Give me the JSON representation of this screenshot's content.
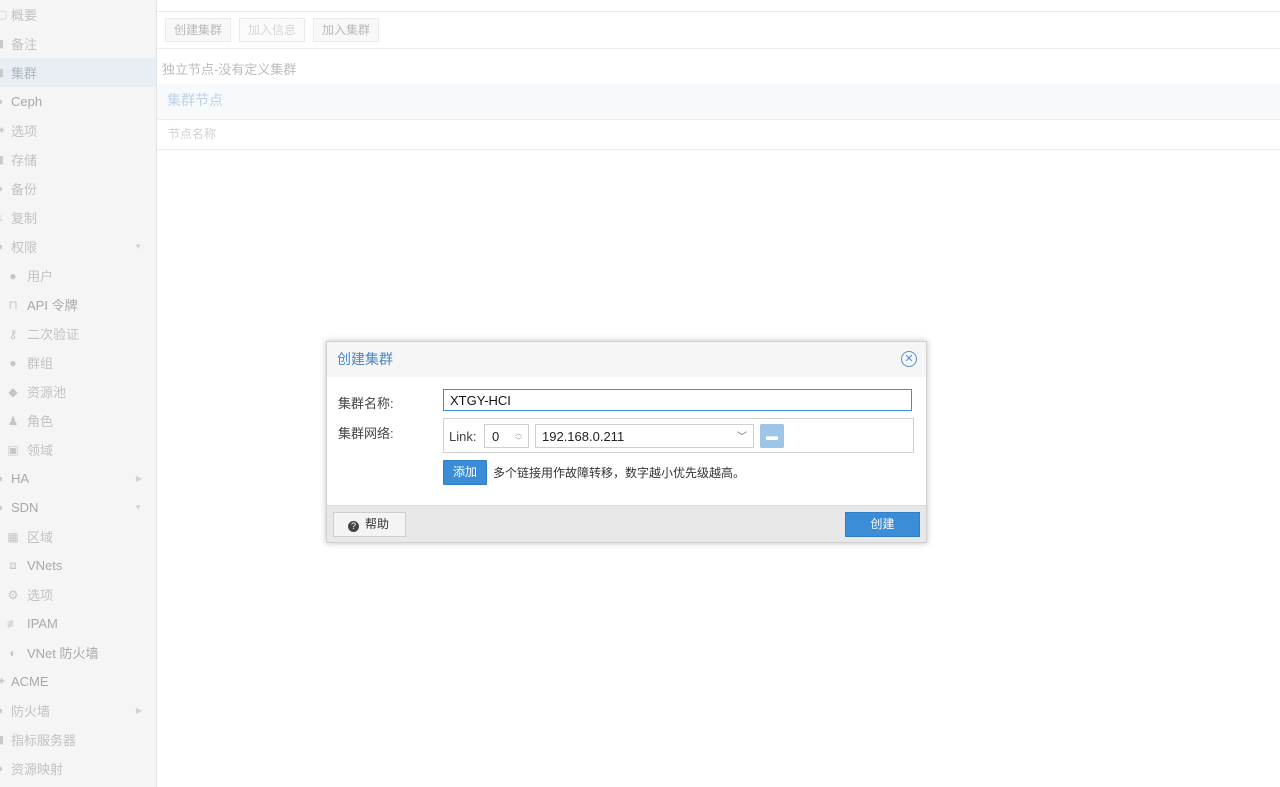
{
  "sidebar": {
    "items": [
      {
        "label": "概要",
        "icon": "summary-icon"
      },
      {
        "label": "备注",
        "icon": "notes-icon"
      },
      {
        "label": "集群",
        "icon": "cluster-icon",
        "selected": true
      },
      {
        "label": "Ceph",
        "icon": "ceph-icon"
      },
      {
        "label": "选项",
        "icon": "options-icon"
      },
      {
        "label": "存储",
        "icon": "storage-icon"
      },
      {
        "label": "备份",
        "icon": "backup-icon"
      },
      {
        "label": "复制",
        "icon": "replication-icon"
      },
      {
        "label": "权限",
        "icon": "permissions-icon",
        "expanded": true
      },
      {
        "label": "用户",
        "icon": "user-icon"
      },
      {
        "label": "API 令牌",
        "icon": "api-token-icon"
      },
      {
        "label": "二次验证",
        "icon": "key-icon"
      },
      {
        "label": "群组",
        "icon": "group-icon"
      },
      {
        "label": "资源池",
        "icon": "pool-tags-icon"
      },
      {
        "label": "角色",
        "icon": "role-icon"
      },
      {
        "label": "领域",
        "icon": "realm-icon"
      },
      {
        "label": "HA",
        "icon": "ha-icon",
        "expanded": false
      },
      {
        "label": "SDN",
        "icon": "sdn-icon",
        "expanded": true
      },
      {
        "label": "区域",
        "icon": "zones-grid-icon"
      },
      {
        "label": "VNets",
        "icon": "vnets-icon"
      },
      {
        "label": "选项",
        "icon": "gear-icon"
      },
      {
        "label": "IPAM",
        "icon": "ipam-icon"
      },
      {
        "label": "VNet 防火墙",
        "icon": "shield-icon"
      },
      {
        "label": "ACME",
        "icon": "acme-icon"
      },
      {
        "label": "防火墙",
        "icon": "firewall-icon",
        "expanded": false
      },
      {
        "label": "指标服务器",
        "icon": "metric-server-icon"
      },
      {
        "label": "资源映射",
        "icon": "resource-mapping-icon"
      }
    ]
  },
  "toolbar": {
    "create_cluster": "创建集群",
    "join_info": "加入信息",
    "join_cluster": "加入集群"
  },
  "main": {
    "standalone_text": "独立节点-没有定义集群",
    "nodes_title": "集群节点",
    "node_name_col": "节点名称"
  },
  "dialog": {
    "title": "创建集群",
    "cluster_name_label": "集群名称:",
    "cluster_name_value": "XTGY-HCI",
    "cluster_network_label": "集群网络:",
    "link_label": "Link:",
    "link_value": "0",
    "ip_value": "192.168.0.211",
    "add_button": "添加",
    "add_hint": "多个链接用作故障转移，数字越小优先级越高。",
    "help_button": "帮助",
    "create_button": "创建"
  },
  "colors": {
    "accent": "#3c8dd8",
    "title_blue": "#4a86c6",
    "selected_bg": "#e9eef4"
  }
}
